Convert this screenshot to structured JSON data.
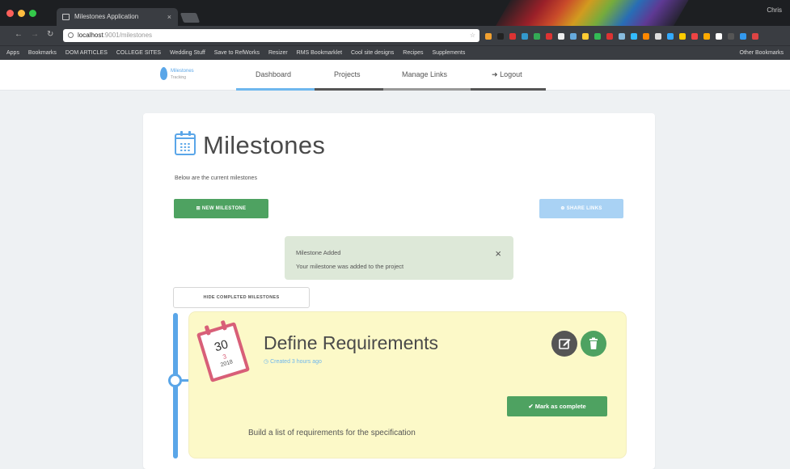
{
  "browser": {
    "tab_title": "Milestones Application",
    "tab_close": "×",
    "user": "Chris",
    "address_host": "localhost",
    "address_path": ":9001/milestones",
    "star": "☆",
    "bookmarks": [
      "Apps",
      "Bookmarks",
      "DOM ARTICLES",
      "COLLEGE SITES",
      "Wedding Stuff",
      "Save to RefWorks",
      "Resizer",
      "RMS Bookmarklet",
      "Cool site designs",
      "Recipes",
      "Supplements"
    ],
    "other_bookmarks": "Other Bookmarks",
    "ext_colors": [
      "#f0a030",
      "#222",
      "#d33",
      "#39c",
      "#3a5",
      "#d33",
      "#eee",
      "#6ad",
      "#fc3",
      "#3b5",
      "#d33",
      "#8bd",
      "#3bf",
      "#f80",
      "#ddd",
      "#3af",
      "#fc0",
      "#e44",
      "#fa0",
      "#fff",
      "#555",
      "#39e",
      "#d44"
    ]
  },
  "app": {
    "logo_top": "Milestones",
    "logo_bottom": "Tracking",
    "nav": [
      "Dashboard",
      "Projects",
      "Manage Links",
      "Logout"
    ],
    "nav_logout_icon": "➜",
    "nav_colors": [
      "#6eb7ee",
      "#555",
      "#999",
      "#555"
    ]
  },
  "page": {
    "title": "Milestones",
    "subtitle": "Below are the current milestones",
    "new_button": "NEW MILESTONE",
    "new_button_icon": "⊞",
    "share_button": "SHARE LINKS",
    "share_button_icon": "⊕",
    "hide_button": "HIDE COMPLETED MILESTONES"
  },
  "alert": {
    "title": "Milestone Added",
    "message": "Your milestone was added to the project",
    "close": "×"
  },
  "milestone": {
    "day": "30",
    "month": "3",
    "year": "2018",
    "title": "Define Requirements",
    "created": "Created 3 hours ago",
    "created_icon": "◷",
    "complete_button": "Mark as complete",
    "complete_icon": "✔",
    "description": "Build a list of requirements for the specification"
  }
}
